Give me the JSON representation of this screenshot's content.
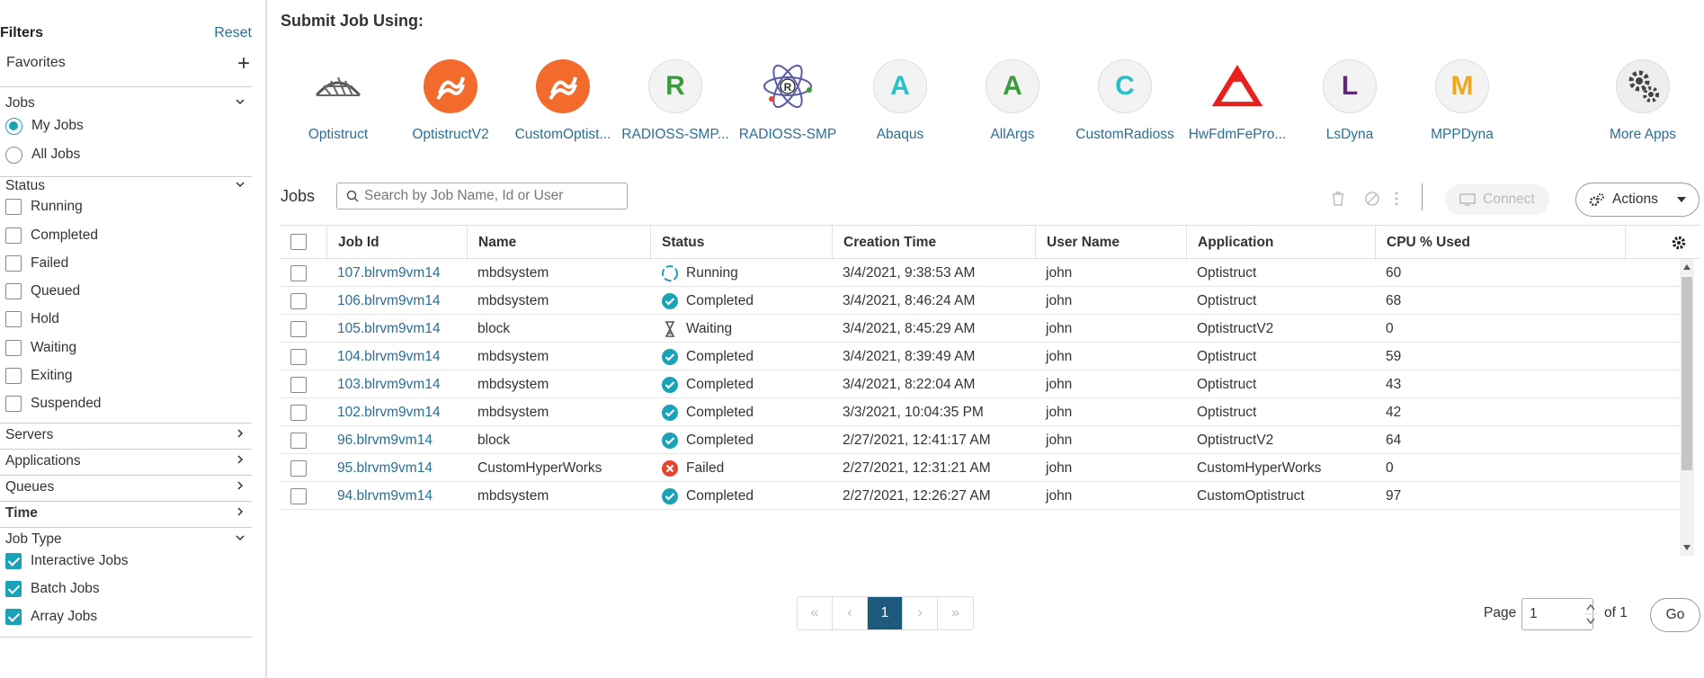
{
  "sidebar": {
    "title": "Filters",
    "reset": "Reset",
    "favorites": "Favorites",
    "jobs": {
      "label": "Jobs",
      "options": [
        "My Jobs",
        "All Jobs"
      ]
    },
    "status": {
      "label": "Status",
      "options": [
        "Running",
        "Completed",
        "Failed",
        "Queued",
        "Hold",
        "Waiting",
        "Exiting",
        "Suspended"
      ]
    },
    "servers": "Servers",
    "applications": "Applications",
    "queues": "Queues",
    "time": "Time",
    "job_type": {
      "label": "Job Type",
      "options": [
        "Interactive Jobs",
        "Batch Jobs",
        "Array Jobs"
      ]
    }
  },
  "submit": {
    "title": "Submit Job Using:",
    "apps": [
      {
        "name": "Optistruct",
        "icon": "optistruct-icon"
      },
      {
        "name": "OptistructV2",
        "icon": "optistruct-v2-icon"
      },
      {
        "name": "CustomOptist...",
        "icon": "custom-optistruct-icon"
      },
      {
        "name": "RADIOSS-SMP...",
        "icon": "radioss-smp-icon",
        "letter": "R"
      },
      {
        "name": "RADIOSS-SMP",
        "icon": "radioss-atom-icon",
        "letter": "R"
      },
      {
        "name": "Abaqus",
        "icon": "abaqus-icon",
        "letter": "A"
      },
      {
        "name": "AllArgs",
        "icon": "allargs-icon",
        "letter": "A"
      },
      {
        "name": "CustomRadioss",
        "icon": "custom-radioss-icon",
        "letter": "C"
      },
      {
        "name": "HwFdmFePro...",
        "icon": "hwfdm-icon"
      },
      {
        "name": "LsDyna",
        "icon": "lsdyna-icon",
        "letter": "L"
      },
      {
        "name": "MPPDyna",
        "icon": "mppdyna-icon",
        "letter": "M"
      },
      {
        "name": "More Apps",
        "icon": "gears-icon"
      }
    ]
  },
  "jobs": {
    "title": "Jobs",
    "search_placeholder": "Search by Job Name, Id or User",
    "connect": "Connect",
    "actions": "Actions",
    "columns": [
      "Job Id",
      "Name",
      "Status",
      "Creation Time",
      "User Name",
      "Application",
      "CPU % Used"
    ],
    "rows": [
      {
        "id": "107.blrvm9vm14",
        "name": "mbdsystem",
        "status": "Running",
        "time": "3/4/2021, 9:38:53 AM",
        "user": "john",
        "app": "Optistruct",
        "cpu": "60"
      },
      {
        "id": "106.blrvm9vm14",
        "name": "mbdsystem",
        "status": "Completed",
        "time": "3/4/2021, 8:46:24 AM",
        "user": "john",
        "app": "Optistruct",
        "cpu": "68"
      },
      {
        "id": "105.blrvm9vm14",
        "name": "block",
        "status": "Waiting",
        "time": "3/4/2021, 8:45:29 AM",
        "user": "john",
        "app": "OptistructV2",
        "cpu": "0"
      },
      {
        "id": "104.blrvm9vm14",
        "name": "mbdsystem",
        "status": "Completed",
        "time": "3/4/2021, 8:39:49 AM",
        "user": "john",
        "app": "Optistruct",
        "cpu": "59"
      },
      {
        "id": "103.blrvm9vm14",
        "name": "mbdsystem",
        "status": "Completed",
        "time": "3/4/2021, 8:22:04 AM",
        "user": "john",
        "app": "Optistruct",
        "cpu": "43"
      },
      {
        "id": "102.blrvm9vm14",
        "name": "mbdsystem",
        "status": "Completed",
        "time": "3/3/2021, 10:04:35 PM",
        "user": "john",
        "app": "Optistruct",
        "cpu": "42"
      },
      {
        "id": "96.blrvm9vm14",
        "name": "block",
        "status": "Completed",
        "time": "2/27/2021, 12:41:17 AM",
        "user": "john",
        "app": "OptistructV2",
        "cpu": "64"
      },
      {
        "id": "95.blrvm9vm14",
        "name": "CustomHyperWorks",
        "status": "Failed",
        "time": "2/27/2021, 12:31:21 AM",
        "user": "john",
        "app": "CustomHyperWorks",
        "cpu": "0"
      },
      {
        "id": "94.blrvm9vm14",
        "name": "mbdsystem",
        "status": "Completed",
        "time": "2/27/2021, 12:26:27 AM",
        "user": "john",
        "app": "CustomOptistruct",
        "cpu": "97"
      }
    ]
  },
  "pagination": {
    "buttons": [
      "«",
      "‹",
      "1",
      "›",
      "»"
    ],
    "page_label": "Page",
    "page_value": "1",
    "of_label": "of 1",
    "go": "Go"
  },
  "colors": {
    "accent": "#1aa3b4",
    "link": "#2a6f97",
    "active_page": "#1d5a7d",
    "failed": "#e8432e"
  }
}
